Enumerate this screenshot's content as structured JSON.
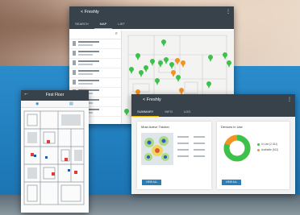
{
  "map_window": {
    "title": "< Freshly",
    "tabs": [
      {
        "label": "SEARCH",
        "active": false
      },
      {
        "label": "MAP",
        "active": true
      },
      {
        "label": "LIST",
        "active": false
      }
    ],
    "list_count": 8
  },
  "floor_window": {
    "title": "First Floor"
  },
  "analytics_window": {
    "title": "< Freshly",
    "tabs": [
      {
        "label": "SUMMARY",
        "active": true
      },
      {
        "label": "INFO",
        "active": false
      },
      {
        "label": "LOG",
        "active": false
      }
    ],
    "heatmap_card": {
      "title": "Most Active Tracker",
      "button_label": "VIEW ALL"
    },
    "donut_card": {
      "title": "Devices in Use",
      "button_label": "VIEW ALL",
      "in_use_fraction": 0.8,
      "legend": [
        "In Use (2,341)",
        "Available (612)"
      ]
    }
  },
  "colors": {
    "appbar": "#37424a",
    "accent_green": "#3cc24a",
    "accent_orange": "#f39221",
    "accent_blue": "#2a7fb8",
    "tab_indicator": "#f0b400"
  }
}
